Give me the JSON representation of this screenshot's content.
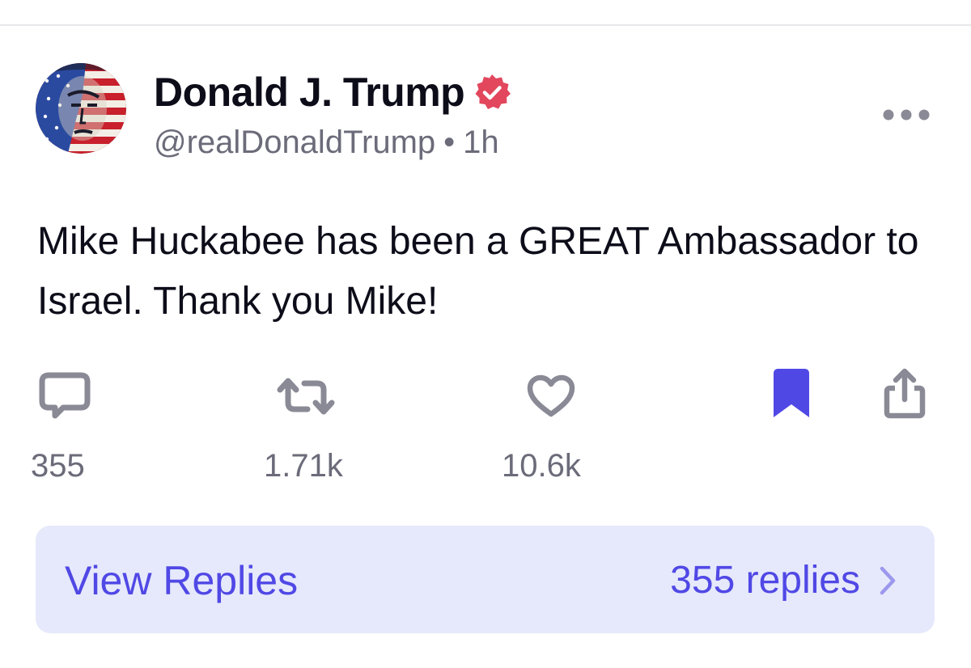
{
  "post": {
    "author_name": "Donald J. Trump",
    "handle": "@realDonaldTrump",
    "separator": "•",
    "timestamp": "1h",
    "text": "Mike Huckabee has been a GREAT Ambassador to Israel. Thank you Mike!"
  },
  "actions": {
    "reply_count": "355",
    "retruth_count": "1.71k",
    "like_count": "10.6k",
    "bookmarked": true
  },
  "replies_bar": {
    "label": "View Replies",
    "count_label": "355 replies"
  },
  "icons": {
    "avatar": "avatar-flag-portrait",
    "verified": "verified-badge-icon",
    "more": "more-horizontal-icon",
    "reply": "comment-icon",
    "retruth": "repost-icon",
    "like": "heart-icon",
    "bookmark": "bookmark-filled-icon",
    "share": "share-icon",
    "chevron": "chevron-right-icon"
  },
  "colors": {
    "accent": "#5048e5",
    "verified": "#e2475d",
    "muted": "#6b6b7a",
    "icon": "#8a8a96",
    "text": "#0d0d1a",
    "replies_bg": "#e6e9fb"
  }
}
